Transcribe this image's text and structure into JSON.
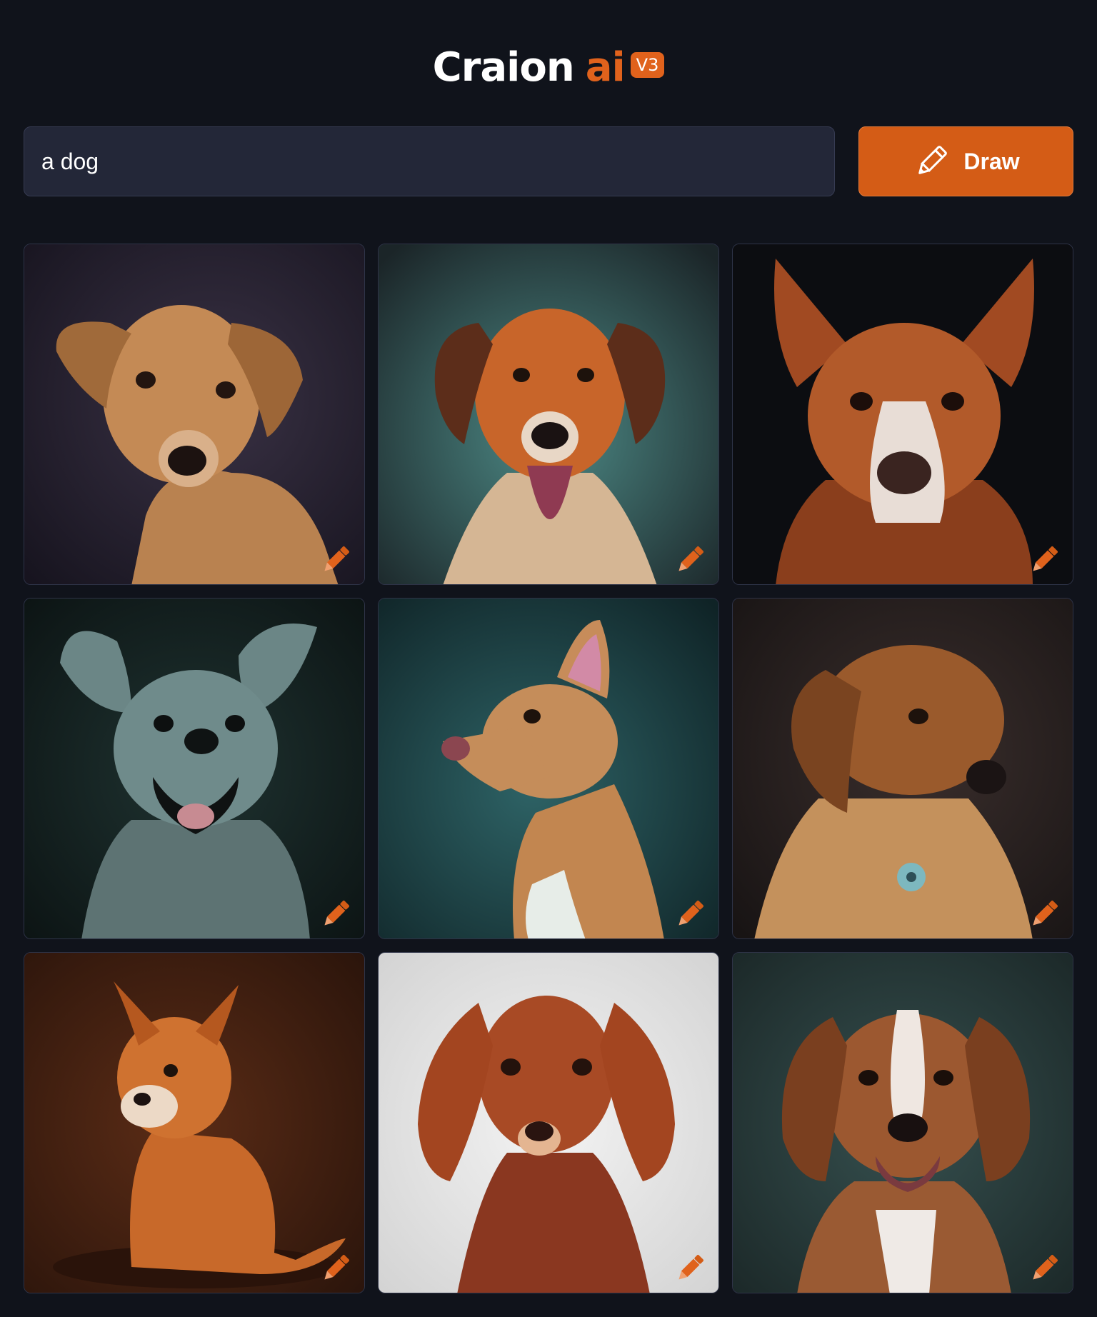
{
  "header": {
    "logo_text": "Craion",
    "logo_ai": "ai",
    "version_badge": "V3"
  },
  "prompt": {
    "value": "a dog"
  },
  "draw_button": {
    "label": "Draw",
    "icon": "pencil-icon"
  },
  "colors": {
    "page_background": "#10131b",
    "accent": "#d45c16",
    "input_background": "#232738"
  },
  "images": [
    {
      "name": "dog-image-1",
      "edit_icon": "pencil-edit-icon"
    },
    {
      "name": "dog-image-2",
      "edit_icon": "pencil-edit-icon"
    },
    {
      "name": "dog-image-3",
      "edit_icon": "pencil-edit-icon"
    },
    {
      "name": "dog-image-4",
      "edit_icon": "pencil-edit-icon"
    },
    {
      "name": "dog-image-5",
      "edit_icon": "pencil-edit-icon"
    },
    {
      "name": "dog-image-6",
      "edit_icon": "pencil-edit-icon"
    },
    {
      "name": "dog-image-7",
      "edit_icon": "pencil-edit-icon"
    },
    {
      "name": "dog-image-8",
      "edit_icon": "pencil-edit-icon"
    },
    {
      "name": "dog-image-9",
      "edit_icon": "pencil-edit-icon"
    }
  ]
}
